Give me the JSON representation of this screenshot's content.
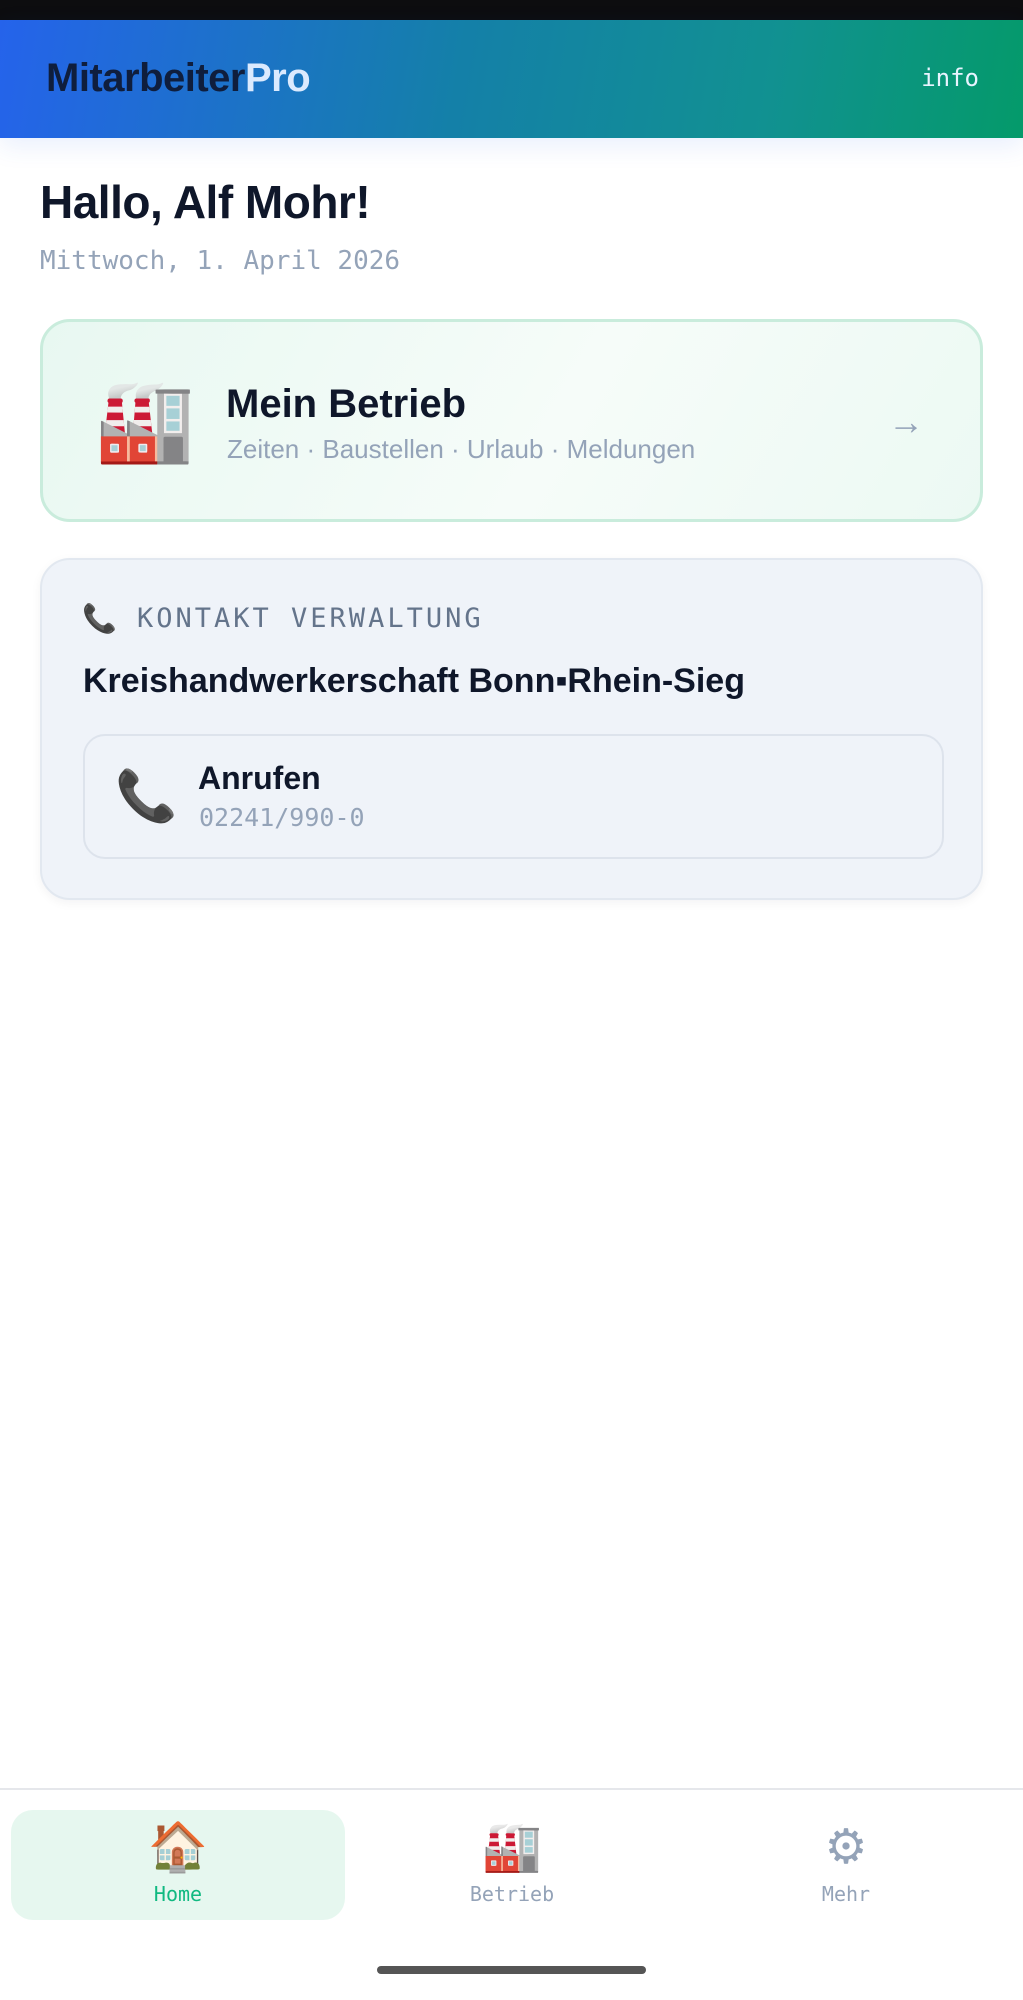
{
  "header": {
    "brand_part1": "Mitarbeiter",
    "brand_part2": "Pro",
    "info_label": "info"
  },
  "welcome": {
    "greeting": "Hallo, Alf Mohr!",
    "date": "Mittwoch, 1. April 2026"
  },
  "betrieb_card": {
    "icon": "🏭",
    "title": "Mein Betrieb",
    "subtitle": "Zeiten · Baustellen · Urlaub · Meldungen",
    "arrow": "→"
  },
  "kontakt": {
    "label_icon": "📞",
    "label": "KONTAKT VERWALTUNG",
    "name": "Kreishandwerkerschaft Bonn▪Rhein-Sieg",
    "call": {
      "icon": "📞",
      "title": "Anrufen",
      "number": "02241/990-0"
    }
  },
  "bottom_nav": {
    "items": [
      {
        "icon": "🏠",
        "label": "Home",
        "active": true
      },
      {
        "icon": "🏭",
        "label": "Betrieb",
        "active": false
      },
      {
        "icon": "⚙",
        "label": "Mehr",
        "active": false
      }
    ]
  },
  "colors": {
    "accent_blue": "#2563eb",
    "accent_green": "#10b981",
    "text_dark": "#0f172a",
    "text_muted": "#94a3b8"
  }
}
